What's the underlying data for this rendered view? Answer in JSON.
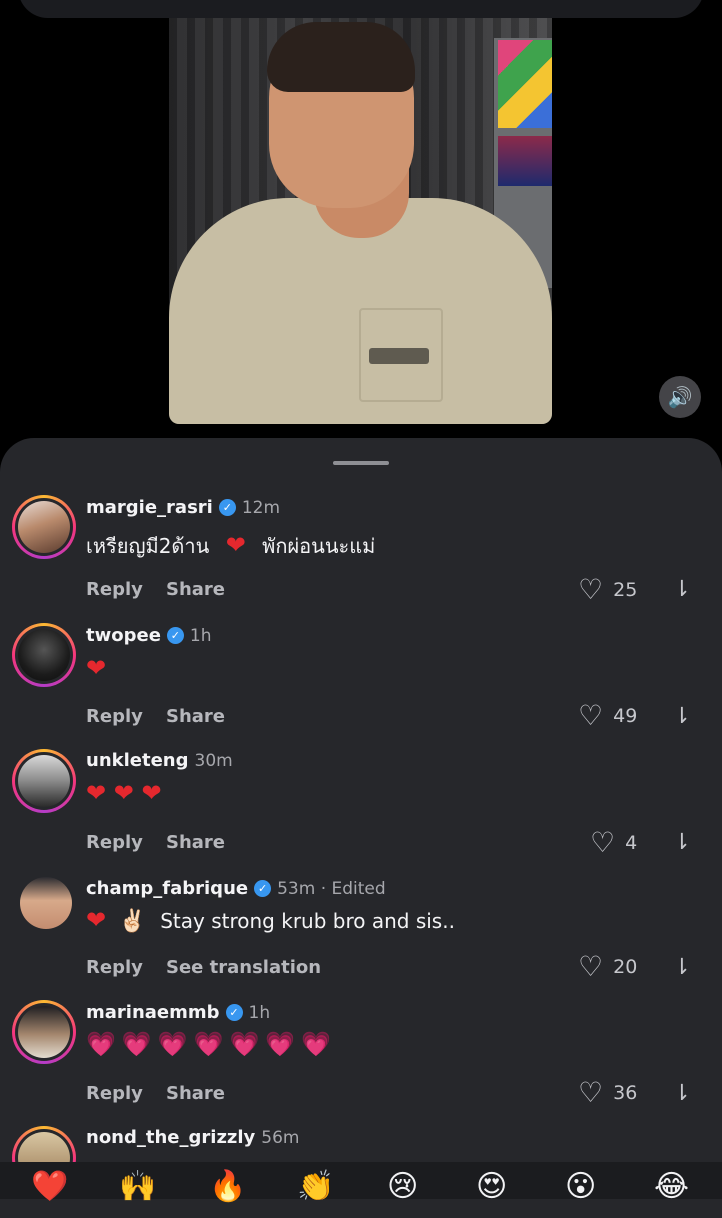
{
  "video": {
    "mute_icon": "speaker-icon",
    "mute_symbol": "🔊"
  },
  "comments": [
    {
      "username": "margie_rasri",
      "verified": true,
      "time": "12m",
      "text_a": "เหรียญมี2ด้าน",
      "heart": "❤",
      "text_b": "พักผ่อนนะแม่",
      "reply": "Reply",
      "secondary": "Share",
      "likes": "25"
    },
    {
      "username": "twopee",
      "verified": true,
      "time": "1h",
      "text": "❤",
      "reply": "Reply",
      "secondary": "Share",
      "likes": "49"
    },
    {
      "username": "unkleteng",
      "verified": false,
      "time": "30m",
      "text": "❤ ❤ ❤",
      "reply": "Reply",
      "secondary": "Share",
      "likes": "4"
    },
    {
      "username": "champ_fabrique",
      "verified": true,
      "time": "53m · Edited",
      "heart": "❤",
      "victory": "✌🏻",
      "text": "Stay strong krub bro and sis..",
      "reply": "Reply",
      "secondary": "See translation",
      "likes": "20"
    },
    {
      "username": "marinaemmb",
      "verified": true,
      "time": "1h",
      "text": "💗💗💗💗💗💗💗",
      "reply": "Reply",
      "secondary": "Share",
      "likes": "36"
    },
    {
      "username": "nond_the_grizzly",
      "verified": false,
      "time": "56m"
    }
  ],
  "icons": {
    "verified": "✓",
    "like": "♡",
    "dislike": "⇂"
  },
  "emoji_bar": [
    "❤️",
    "🙌",
    "🔥",
    "👏",
    "😢",
    "😍",
    "😮",
    "😂"
  ],
  "colors": {
    "sheet": "#26272b",
    "verified": "#3897f0",
    "heart": "#e5282e"
  }
}
